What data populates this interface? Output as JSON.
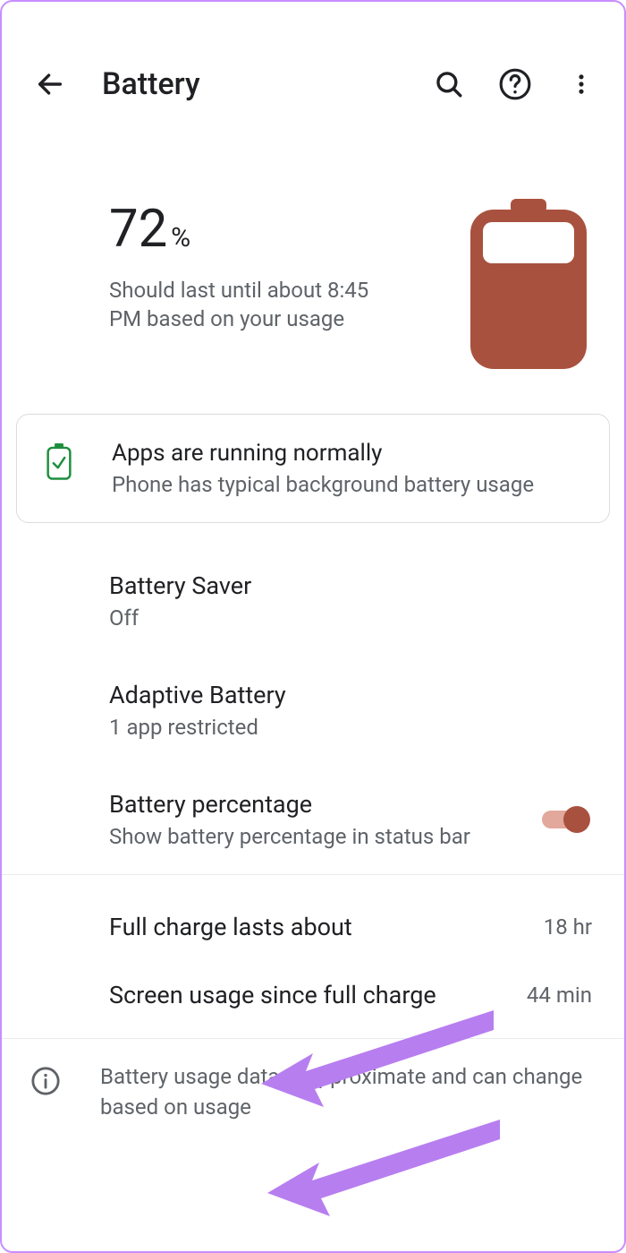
{
  "header": {
    "title": "Battery"
  },
  "summary": {
    "percent": "72",
    "percent_sign": "%",
    "estimate": "Should last until about 8:45 PM based on your usage"
  },
  "status_card": {
    "title": "Apps are running normally",
    "subtitle": "Phone has typical background battery usage"
  },
  "rows": {
    "battery_saver": {
      "title": "Battery Saver",
      "subtitle": "Off"
    },
    "adaptive": {
      "title": "Adaptive Battery",
      "subtitle": "1 app restricted"
    },
    "percentage": {
      "title": "Battery percentage",
      "subtitle": "Show battery percentage in status bar",
      "on": true
    }
  },
  "stats": {
    "full_charge": {
      "label": "Full charge lasts about",
      "value": "18 hr"
    },
    "screen_usage": {
      "label": "Screen usage since full charge",
      "value": "44 min"
    }
  },
  "footer": {
    "text": "Battery usage data is approximate and can change based on usage"
  },
  "colors": {
    "accent": "#a9513f",
    "accent_light": "#e2a89b",
    "annotation": "#b77ef0",
    "text_secondary": "#5f6368",
    "status_green": "#1e8e3e"
  }
}
